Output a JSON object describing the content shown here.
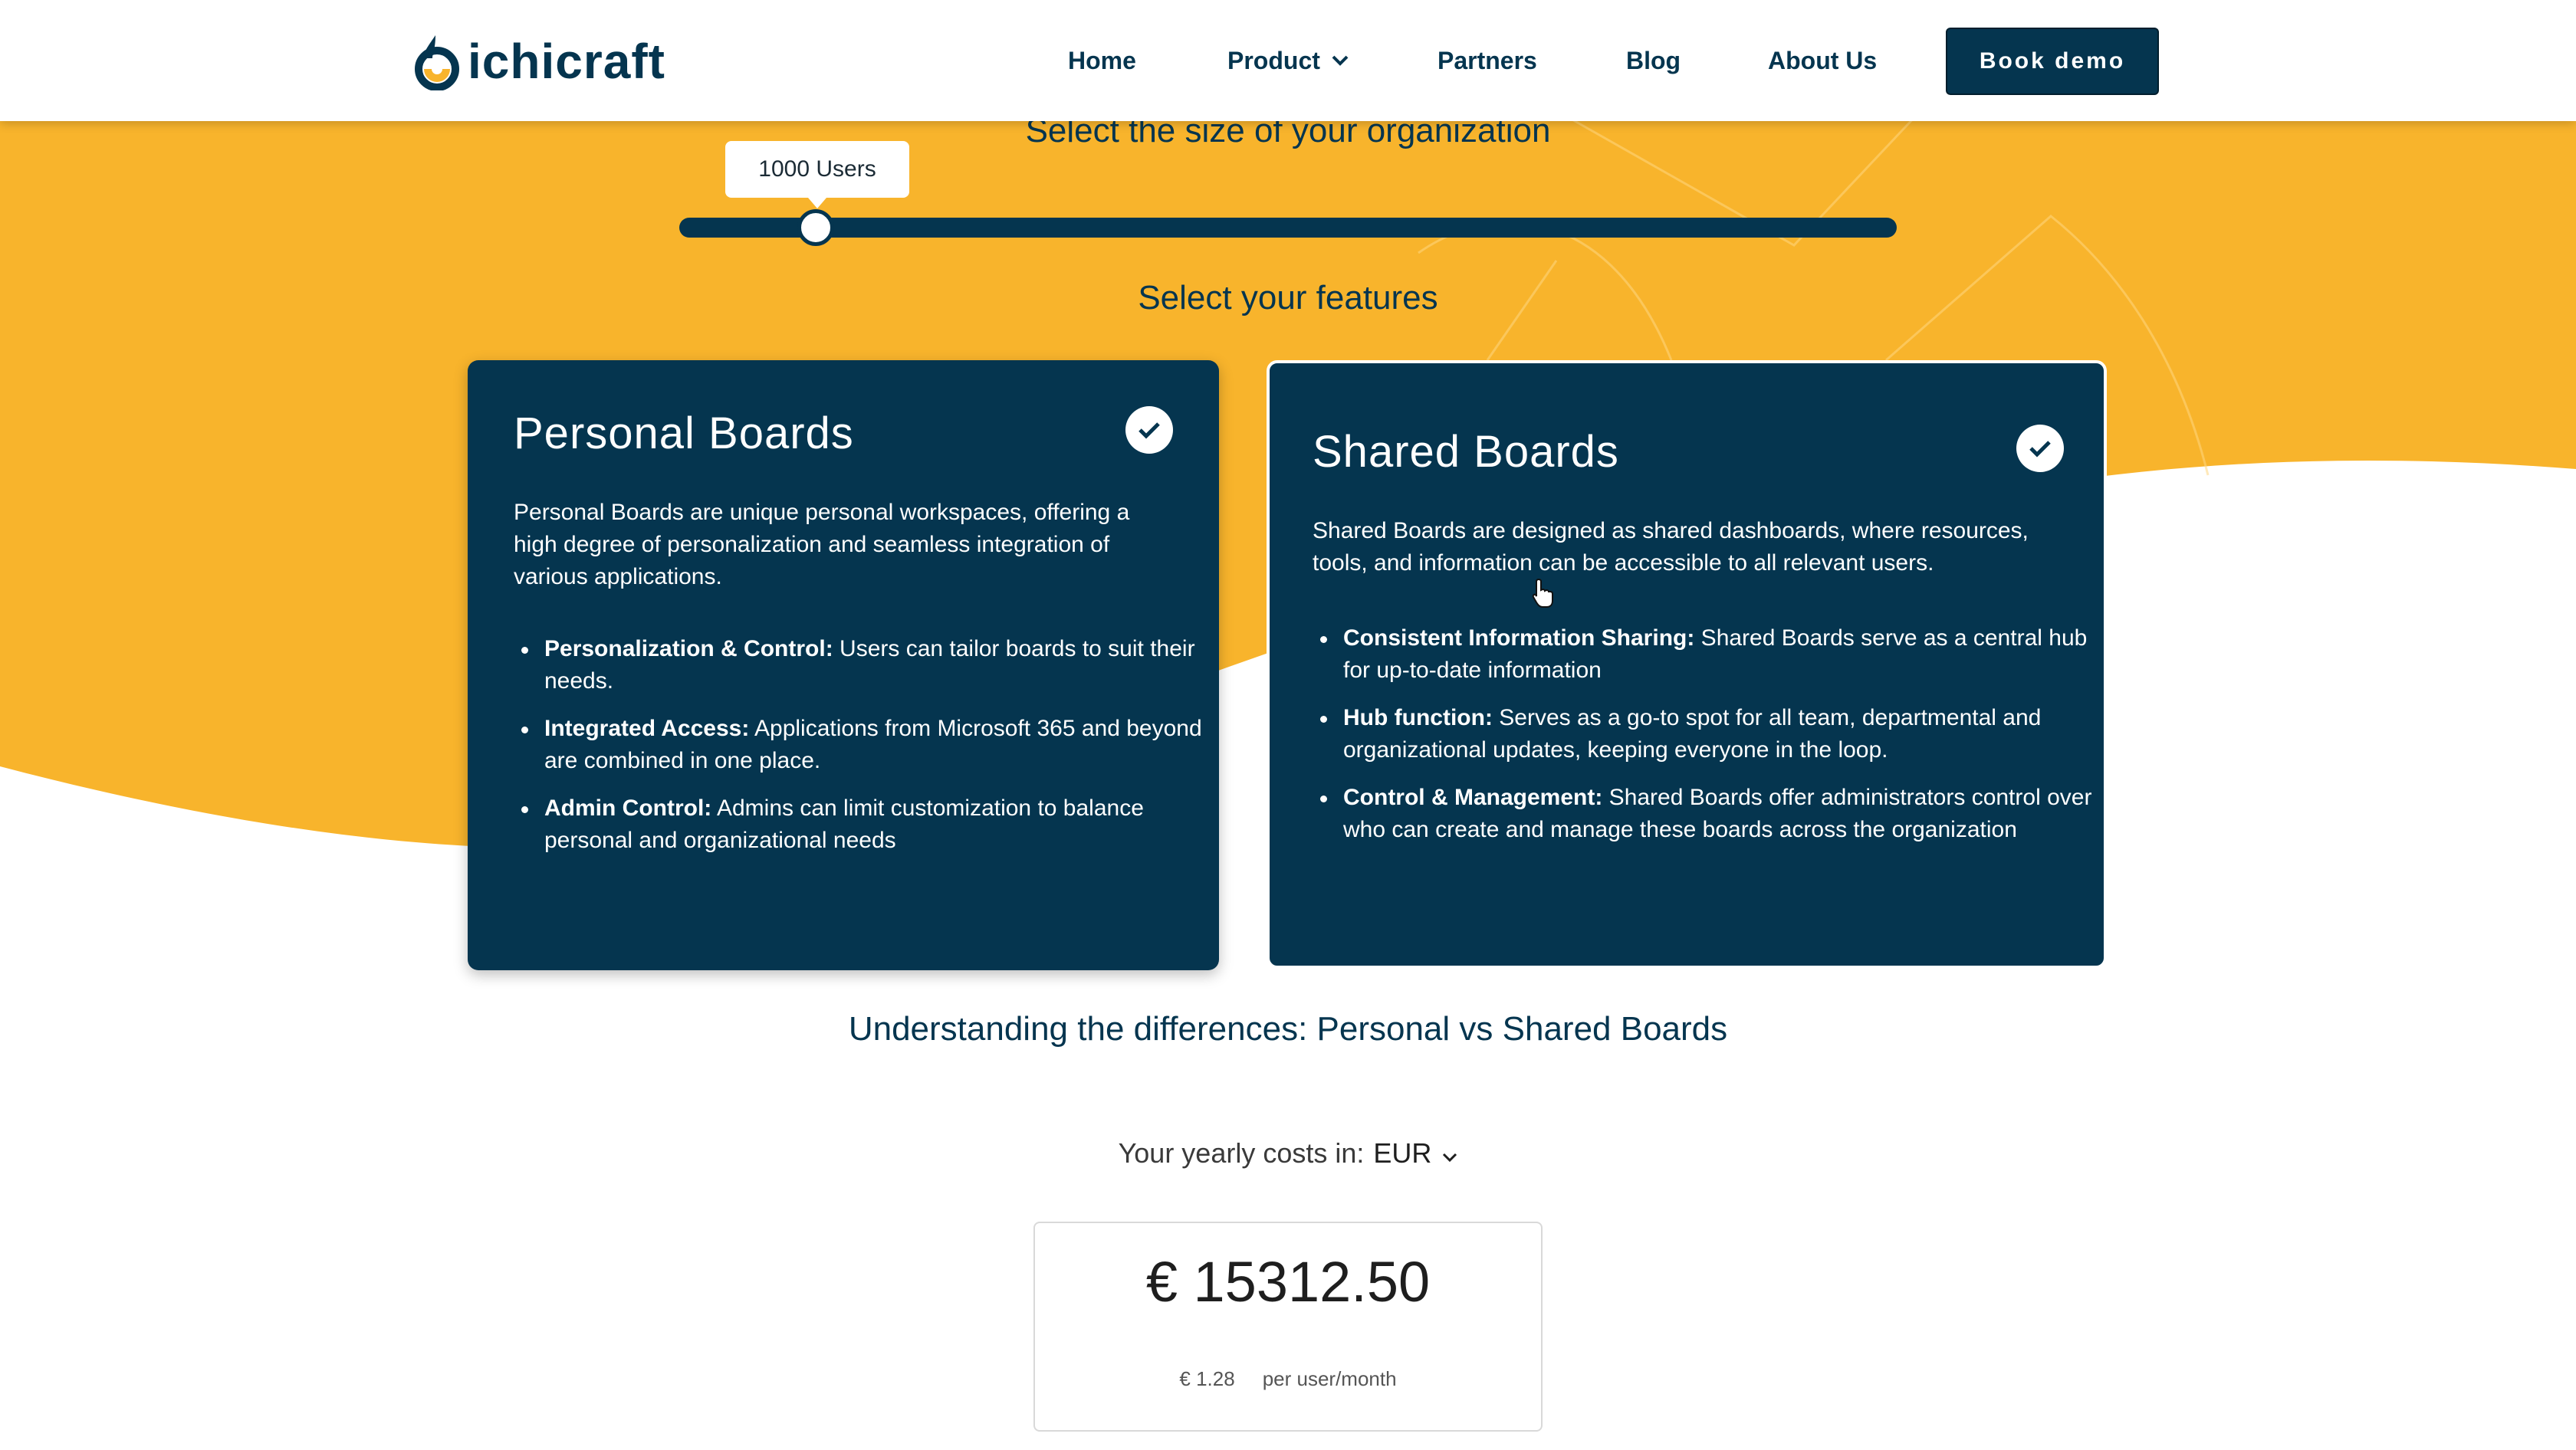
{
  "nav": {
    "logo_text": "ichicraft",
    "items": [
      "Home",
      "Product",
      "Partners",
      "Blog",
      "About Us"
    ],
    "book_demo": "Book demo"
  },
  "org_size": {
    "title": "Select the size of your organization",
    "slider_label": "1000 Users",
    "slider_value": 1000
  },
  "features": {
    "title": "Select your features",
    "cards": [
      {
        "title": "Personal Boards",
        "selected": true,
        "description": "Personal Boards are unique personal workspaces, offering a high degree of personalization and seamless integration of various applications.",
        "bullets": [
          {
            "bold": "Personalization & Control:",
            "text": " Users can tailor boards to suit their needs."
          },
          {
            "bold": "Integrated Access:",
            "text": " Applications from Microsoft 365 and beyond are combined in one place."
          },
          {
            "bold": "Admin Control:",
            "text": " Admins can limit customization to balance personal and organizational needs"
          }
        ]
      },
      {
        "title": "Shared Boards",
        "selected": true,
        "description": "Shared Boards are designed as shared dashboards, where resources, tools, and information can be accessible to all relevant users.",
        "bullets": [
          {
            "bold": "Consistent Information Sharing:",
            "text": " Shared Boards serve as a central hub for up-to-date information"
          },
          {
            "bold": "Hub function:",
            "text": " Serves as a go-to spot for all team, departmental and organizational updates, keeping everyone in the loop."
          },
          {
            "bold": "Control & Management:",
            "text": " Shared Boards offer administrators control over who can create and manage these boards across the organization"
          }
        ]
      }
    ]
  },
  "differences_link": "Understanding the differences: Personal vs Shared Boards",
  "costs": {
    "label": "Your yearly costs in:",
    "currency": "EUR",
    "total": "€ 15312.50",
    "per_user_price": "€ 1.28",
    "per_user_unit": "per user/month"
  },
  "colors": {
    "navy": "#05354f",
    "yellow": "#f8b42c",
    "white": "#ffffff"
  }
}
